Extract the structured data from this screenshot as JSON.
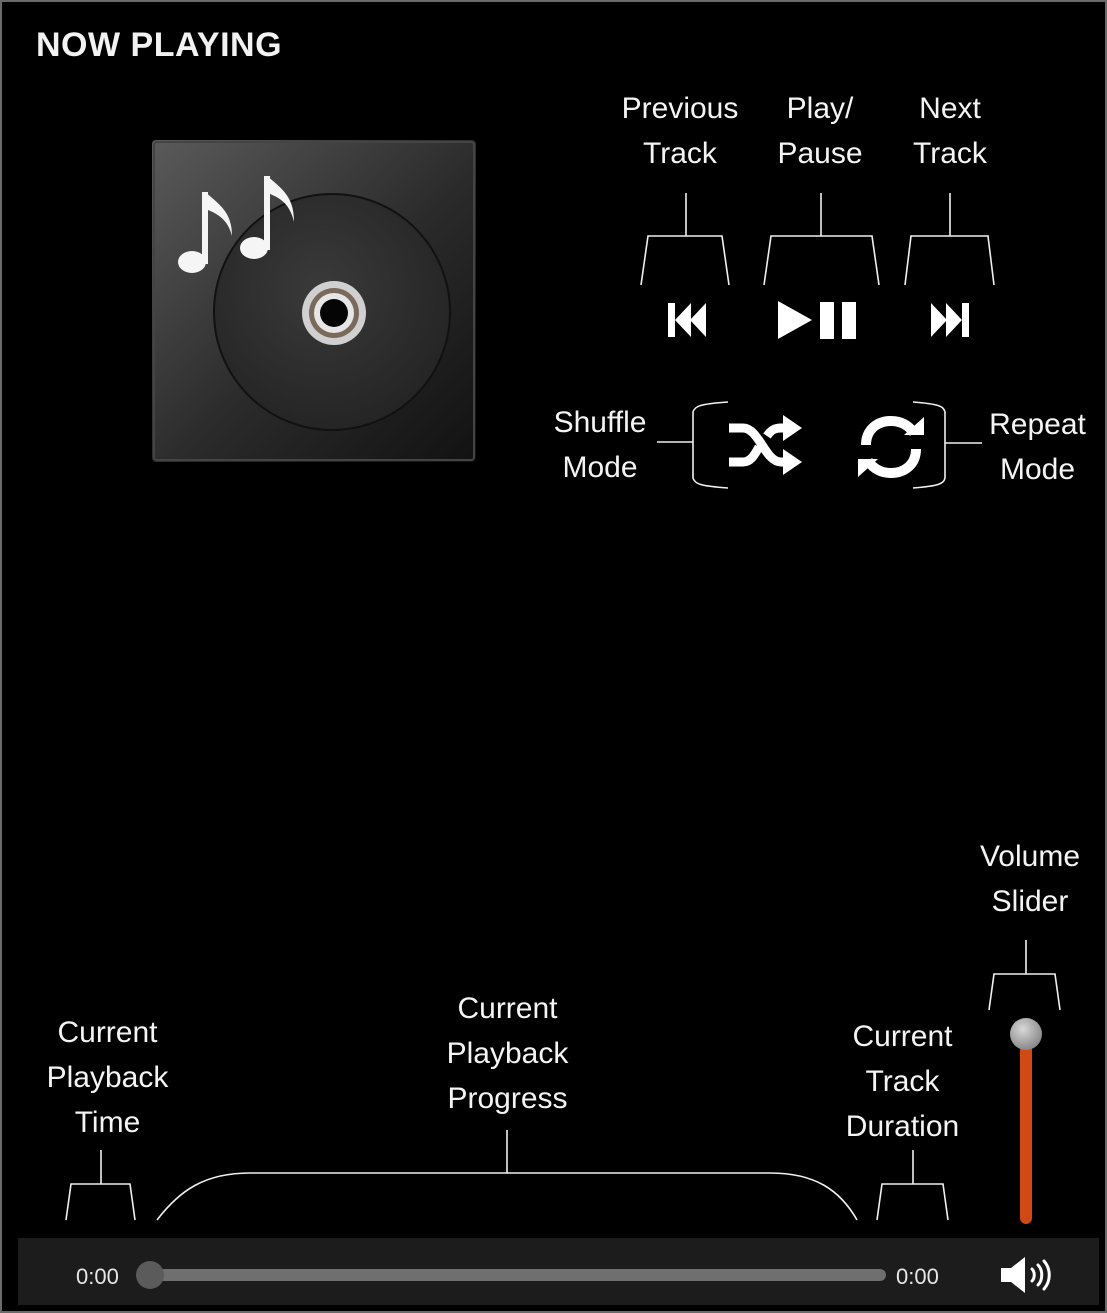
{
  "header": {
    "title": "NOW PLAYING"
  },
  "transport": {
    "previous_label": "Previous Track",
    "previous_lines": [
      "Previous",
      "Track"
    ],
    "playpause_lines": [
      "Play/",
      "Pause"
    ],
    "next_lines": [
      "Next",
      "Track"
    ]
  },
  "modes": {
    "shuffle_lines": [
      "Shuffle",
      "Mode"
    ],
    "repeat_lines": [
      "Repeat",
      "Mode"
    ]
  },
  "bottom_labels": {
    "playback_time_lines": [
      "Current",
      "Playback",
      "Time"
    ],
    "playback_progress_lines": [
      "Current",
      "Playback",
      "Progress"
    ],
    "track_duration_lines": [
      "Current",
      "Track",
      "Duration"
    ],
    "volume_slider_lines": [
      "Volume",
      "Slider"
    ]
  },
  "playback": {
    "current_time": "0:00",
    "duration": "0:00",
    "progress_fraction": 0.0
  },
  "volume": {
    "level_fraction": 1.0
  },
  "icons": {
    "album_art": "music-cd-icon",
    "previous": "skip-previous-icon",
    "playpause": "play-pause-icon",
    "next": "skip-next-icon",
    "shuffle": "shuffle-icon",
    "repeat": "repeat-icon",
    "volume": "speaker-icon"
  },
  "colors": {
    "background": "#000000",
    "accent": "#d24a12",
    "bar": "#1c1c1c",
    "text": "#f4f4f4"
  }
}
